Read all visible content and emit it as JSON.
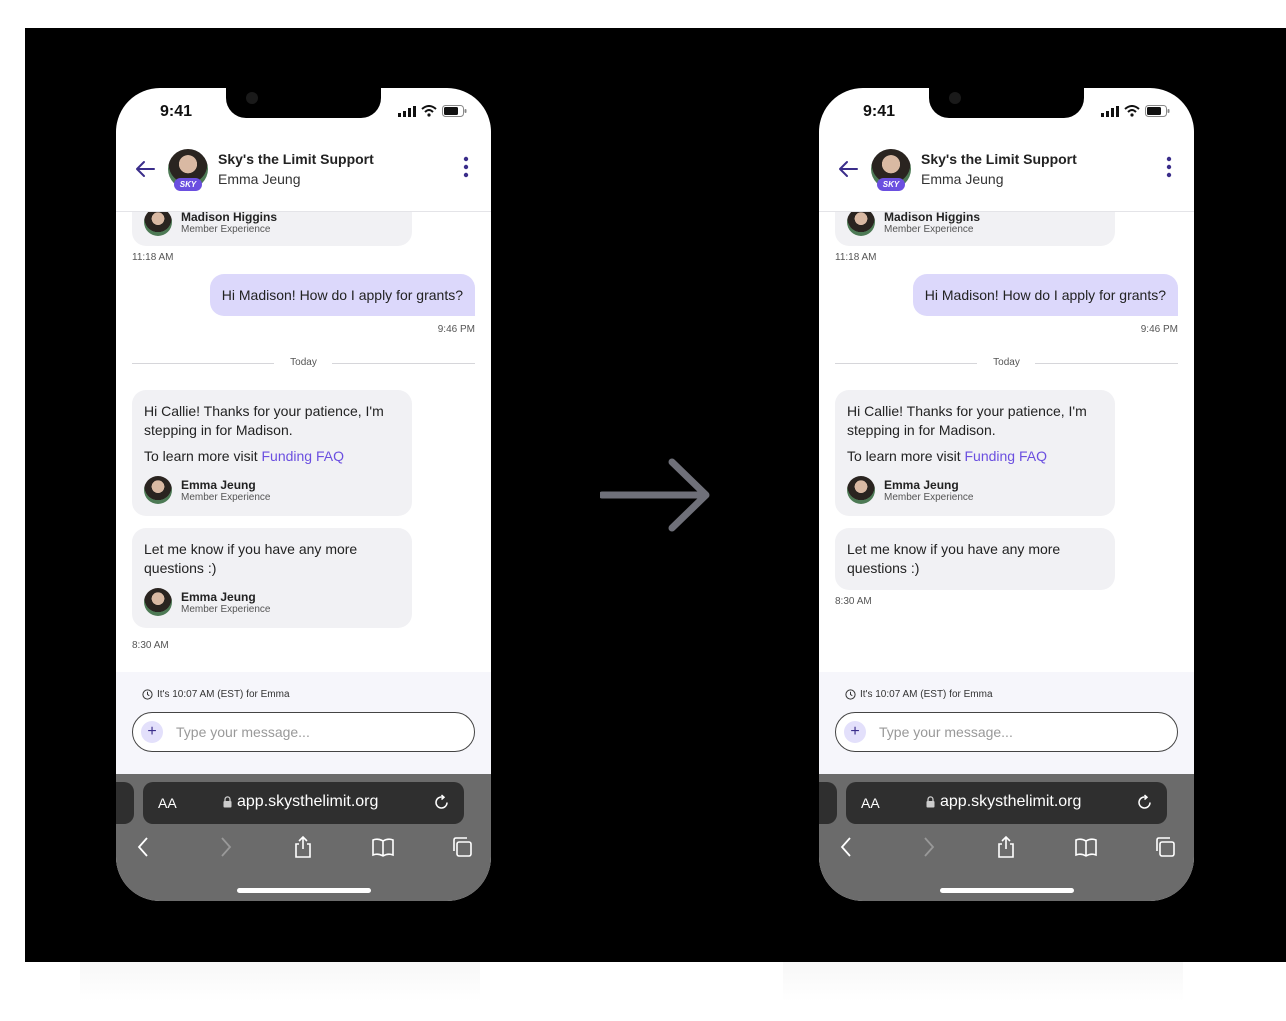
{
  "status_bar": {
    "time": "9:41"
  },
  "header": {
    "title": "Sky's the Limit Support",
    "subtitle": "Emma Jeung",
    "badge": "SKY"
  },
  "chat": {
    "prev_sender_name": "Madison Higgins",
    "prev_sender_role": "Member Experience",
    "prev_timestamp": "11:18 AM",
    "user_message": "Hi Madison! How do I apply for grants?",
    "user_timestamp": "9:46 PM",
    "divider_label": "Today",
    "msg1_text": "Hi Callie! Thanks for your patience, I'm stepping in for Madison.",
    "msg1_link_prefix": "To learn more visit ",
    "msg1_link": "Funding FAQ",
    "msg2_text": "Let me know if you have any more questions :)",
    "agent_name": "Emma Jeung",
    "agent_role": "Member Experience",
    "last_timestamp": "8:30 AM"
  },
  "composer": {
    "timezone_note": "It's 10:07 AM (EST) for Emma",
    "placeholder": "Type your message..."
  },
  "browser": {
    "text_size_label": "AA",
    "url": "app.skysthelimit.org"
  },
  "icons": [
    "back-arrow-icon",
    "kebab-menu-icon",
    "clock-icon",
    "plus-icon",
    "lock-icon",
    "reload-icon",
    "chevron-left-icon",
    "chevron-right-icon",
    "share-icon",
    "bookmarks-icon",
    "tabs-icon",
    "arrow-right-icon"
  ],
  "colors": {
    "accent": "#6b4fe0",
    "user_bubble": "#dcd8fb",
    "agent_bubble": "#f1f1f4",
    "background": "#000000"
  }
}
